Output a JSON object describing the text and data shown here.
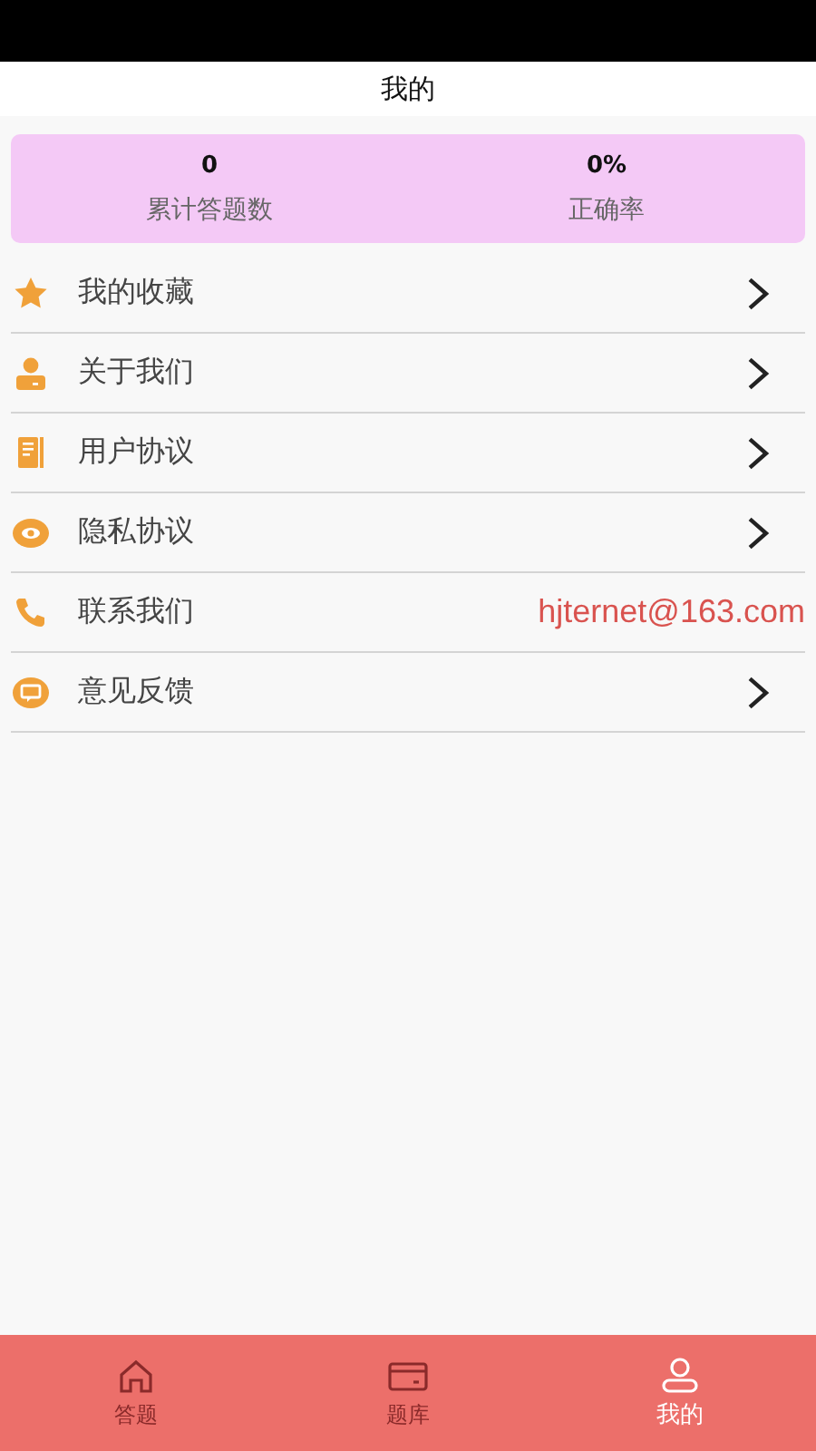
{
  "header": {
    "title": "我的"
  },
  "stats": [
    {
      "value": "0",
      "label": "累计答题数"
    },
    {
      "value": "0%",
      "label": "正确率"
    }
  ],
  "menu": [
    {
      "kind": "link",
      "label": "我的收藏"
    },
    {
      "kind": "link",
      "label": "关于我们"
    },
    {
      "kind": "link",
      "label": "用户协议"
    },
    {
      "kind": "link",
      "label": "隐私协议"
    },
    {
      "kind": "contact",
      "label": "联系我们",
      "value": "hjternet@163.com"
    },
    {
      "kind": "link",
      "label": "意见反馈"
    }
  ],
  "tabs": [
    {
      "label": "答题",
      "selected": false
    },
    {
      "label": "题库",
      "selected": false
    },
    {
      "label": "我的",
      "selected": true
    }
  ]
}
